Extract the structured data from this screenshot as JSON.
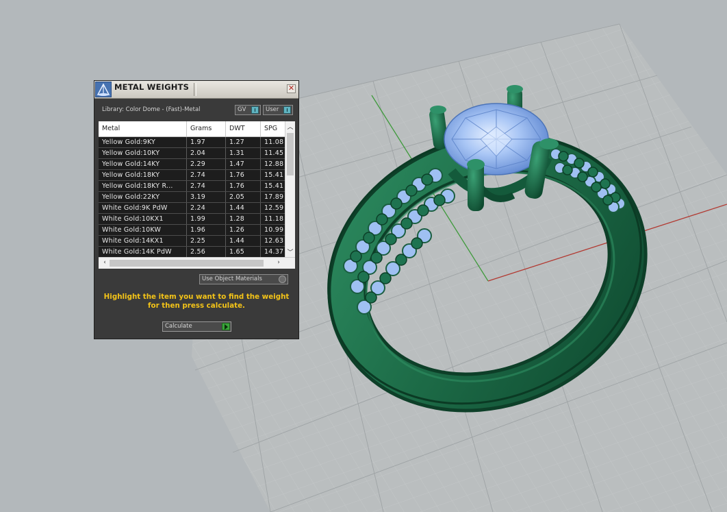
{
  "panel": {
    "title": "METAL WEIGHTS",
    "library_label": "Library: Color Dome - (Fast)-Metal",
    "toggles": {
      "gv_label": "GV",
      "user_label": "User"
    },
    "table": {
      "columns": [
        "Metal",
        "Grams",
        "DWT",
        "SPG"
      ],
      "rows": [
        [
          "Yellow Gold:9KY",
          "1.97",
          "1.27",
          "11.08"
        ],
        [
          "Yellow Gold:10KY",
          "2.04",
          "1.31",
          "11.45"
        ],
        [
          "Yellow Gold:14KY",
          "2.29",
          "1.47",
          "12.88"
        ],
        [
          "Yellow Gold:18KY",
          "2.74",
          "1.76",
          "15.41"
        ],
        [
          "Yellow Gold:18KY R...",
          "2.74",
          "1.76",
          "15.41"
        ],
        [
          "Yellow Gold:22KY",
          "3.19",
          "2.05",
          "17.89"
        ],
        [
          "White Gold:9K PdW",
          "2.24",
          "1.44",
          "12.59"
        ],
        [
          "White Gold:10KX1",
          "1.99",
          "1.28",
          "11.18"
        ],
        [
          "White Gold:10KW",
          "1.96",
          "1.26",
          "10.99"
        ],
        [
          "White Gold:14KX1",
          "2.25",
          "1.44",
          "12.63"
        ],
        [
          "White Gold:14K PdW",
          "2.56",
          "1.65",
          "14.37"
        ]
      ]
    },
    "use_object_materials_label": "Use Object Materials",
    "hint": "Highlight the item you want to find the weight for then press calculate.",
    "calculate_label": "Calculate"
  },
  "colors": {
    "viewport_bg": "#b3b8bb",
    "ring_metal": "#1f6b48",
    "gem": "#8fb6f2",
    "x_axis": "#b23a32",
    "y_axis": "#3f9a3c",
    "hint_text": "#f3c318"
  },
  "icons": {
    "title_icon": "scale-icon",
    "close": "close-icon",
    "calculate": "play-icon"
  }
}
